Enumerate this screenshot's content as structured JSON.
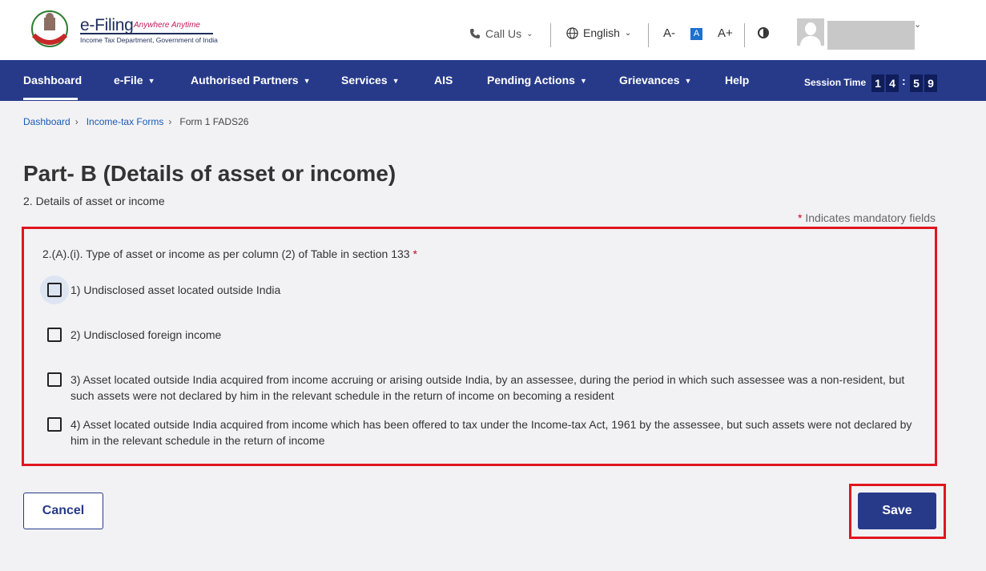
{
  "header": {
    "logo_title": "e-Filing",
    "logo_tagline": "Anywhere Anytime",
    "logo_department": "Income Tax Department, Government of India",
    "call_us": "Call Us",
    "language": "English",
    "font_decrease": "A-",
    "font_default": "A",
    "font_increase": "A+",
    "brand_color": "#273a8a"
  },
  "nav": {
    "items": [
      {
        "label": "Dashboard"
      },
      {
        "label": "e-File"
      },
      {
        "label": "Authorised Partners"
      },
      {
        "label": "Services"
      },
      {
        "label": "AIS"
      },
      {
        "label": "Pending Actions"
      },
      {
        "label": "Grievances"
      },
      {
        "label": "Help"
      }
    ],
    "session_label": "Session Time",
    "session_digits": [
      "1",
      "4",
      "5",
      "9"
    ]
  },
  "breadcrumb": {
    "items": [
      "Dashboard",
      "Income-tax Forms",
      "Form 1 FADS26"
    ]
  },
  "page": {
    "title": "Part- B (Details of asset or income)",
    "subtitle": "2. Details of asset or income",
    "mandatory_star": "*",
    "mandatory_note": " Indicates mandatory fields"
  },
  "form": {
    "question": "2.(A).(i). Type of asset or income as per column (2) of Table in section 133",
    "required_star": "*",
    "options": [
      {
        "label": "1) Undisclosed asset located outside India",
        "checked": false
      },
      {
        "label": "2) Undisclosed foreign income",
        "checked": false
      },
      {
        "label": "3) Asset located outside India acquired from income accruing or arising outside India, by an assessee, during the period in which such assessee was a non-resident, but such assets were not declared by him in the relevant schedule in the return of income on becoming a resident",
        "checked": false
      },
      {
        "label": "4) Asset located outside India acquired from income which has been offered to tax under the Income-tax Act, 1961 by the assessee, but such assets were not declared by him in the relevant schedule in the return of income",
        "checked": false
      }
    ]
  },
  "actions": {
    "cancel": "Cancel",
    "save": "Save"
  }
}
